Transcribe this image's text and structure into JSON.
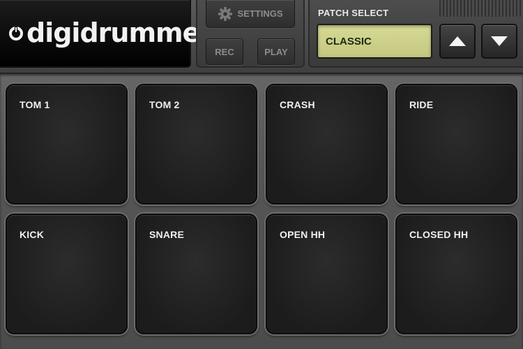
{
  "app": {
    "logo_text": "digidrummer",
    "logo_icon": "power-ring-icon"
  },
  "controls": {
    "settings_label": "SETTINGS",
    "settings_icon": "gear-icon",
    "rec_label": "REC",
    "play_label": "PLAY"
  },
  "patch": {
    "title": "PATCH SELECT",
    "current": "CLASSIC",
    "up_icon": "triangle-up-icon",
    "down_icon": "triangle-down-icon"
  },
  "pads": [
    {
      "label": "TOM 1"
    },
    {
      "label": "TOM 2"
    },
    {
      "label": "CRASH"
    },
    {
      "label": "RIDE"
    },
    {
      "label": "KICK"
    },
    {
      "label": "SNARE"
    },
    {
      "label": "OPEN HH"
    },
    {
      "label": "CLOSED HH"
    }
  ],
  "colors": {
    "lcd": "#d2d58f",
    "pad": "#202020",
    "background": "#4a4a4a"
  }
}
